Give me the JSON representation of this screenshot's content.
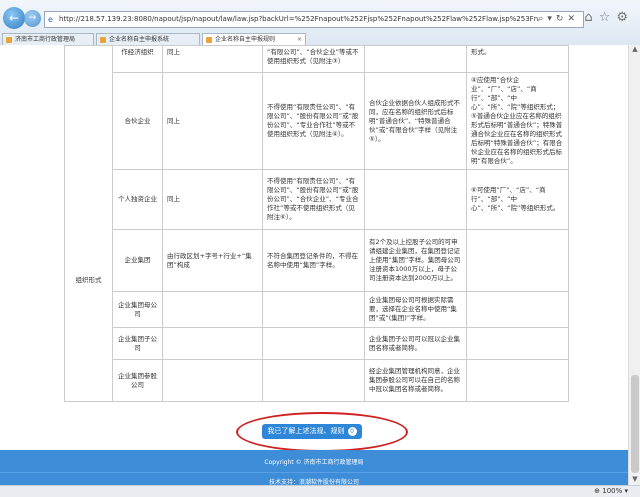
{
  "browser": {
    "url": "http://218.57.139.23:8080/napout/jsp/napout/law/law.jsp?backUrl=%252Fnapout%252Fjsp%252Fnapout%252Flaw%252Flaw.jsp%253Fnat%253D0bak",
    "zoom": "100%",
    "tabs": [
      {
        "label": "济南市工商行政管理局"
      },
      {
        "label": "企业名称自主申报系统"
      },
      {
        "label": "企业名称自主申报规则"
      }
    ]
  },
  "table": {
    "section_label": "组织形式",
    "rows": [
      {
        "name": "作经济组织",
        "rule": "同上",
        "restriction": "“有限公司”、“合伙企业”等或不使用组织形式（见附注③）",
        "notes": "",
        "extra": "形式。"
      },
      {
        "name": "合伙企业",
        "rule": "同上",
        "restriction": "不得使用“有限责任公司”、“有限公司”、“股份有限公司”或“股份公司”、“专业合作社”等或不使用组织形式（见附注④）。",
        "notes": "合伙企业依据合伙人组成形式不同，应在名称的组织形式后标明“普通合伙”、“特殊普通合伙”或“有限合伙”字样（见附注⑤）。",
        "extra": "④应使用“合伙企业”、“厂”、“店”、“商行”、“部”、“中心”、“所”、“院”等组织形式；⑤普通合伙企业应在名称的组织形式后标明“普通合伙”；特殊普通合伙企业应在名称的组织形式后标明“特殊普通合伙”；有限合伙企业应在名称的组织形式后标明“有限合伙”。"
      },
      {
        "name": "个人独资企业",
        "rule": "同上",
        "restriction": "不得使用“有限责任公司”、“有限公司”、“股份有限公司”或“股份公司”、“合伙企业”、“专业合作社”等或不使用组织形式（见附注⑥）。",
        "notes": "",
        "extra": "⑥可使用“厂”、“店”、“商行”、“部”、“中心”、“所”、“院”等组织形式。"
      },
      {
        "name": "企业集团",
        "rule": "由行政区划+字号+行业+“集团”构成",
        "restriction": "不符合集团登记条件的，不得在名称中使用“集团”字样。",
        "notes": "有2个及以上控股子公司的可申请组建企业集团，在集团登记证上使用“集团”字样。集团母公司注册资本1000万以上，母子公司注册资本达到2000万以上。",
        "extra": ""
      },
      {
        "name": "企业集团母公司",
        "rule": "",
        "restriction": "",
        "notes": "企业集团母公司可根据实际需要，选择在企业名称中使用“集团”或“(集团)”字样。",
        "extra": ""
      },
      {
        "name": "企业集团子公司",
        "rule": "",
        "restriction": "",
        "notes": "企业集团子公司可以冠以企业集团名称或者简称。",
        "extra": ""
      },
      {
        "name": "企业集团参股公司",
        "rule": "",
        "restriction": "",
        "notes": "经企业集团管理机构同意，企业集团参股公司可以在自己的名称中冠以集团名称或者简称。",
        "extra": ""
      }
    ]
  },
  "agree_button": {
    "label": "我已了解上述法规、规则",
    "count": "0"
  },
  "footer": {
    "copyright": "Copyright © 济南市工商行政管理局",
    "support": "技术支持：浪潮软件股份有限公司"
  }
}
